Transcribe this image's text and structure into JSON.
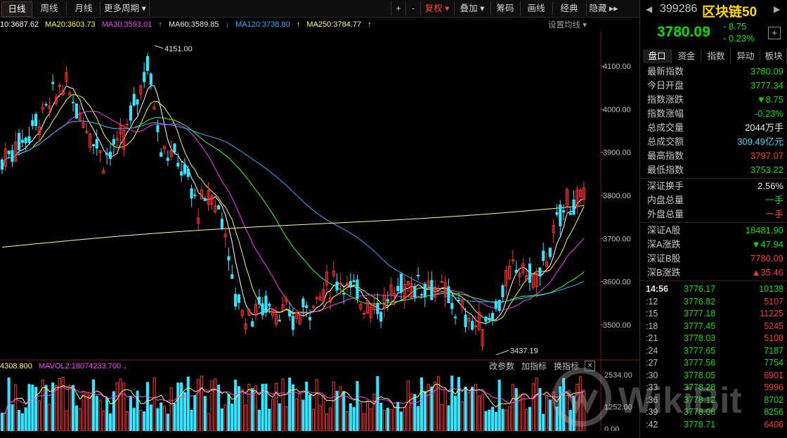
{
  "toolbar": {
    "tabs": [
      "日线",
      "周线",
      "月线",
      "更多周期 ▾"
    ],
    "right_items": [
      "+",
      "-",
      "复权 ▾",
      "叠加 ▾",
      "筹码",
      "画线",
      "经典",
      "隐藏 ▸▸"
    ]
  },
  "ma_row": {
    "ma10": "10:3687.62",
    "ma20": "MA20:3603.73",
    "ma30": "MA30:3593.01",
    "ma60": "MA60:3589.85",
    "ma120": "MA120:3738.80",
    "ma250": "MA250:3784.77",
    "settings": "设置均线 ▾"
  },
  "colors": {
    "up": "#ff3333",
    "down": "#33e6ff",
    "ma10": "#ffffff",
    "ma20": "#ffff00",
    "ma30": "#ff33ff",
    "ma60": "#33ff33",
    "ma120": "#33aaff",
    "ma250": "#ffff88"
  },
  "chart_data": {
    "type": "candlestick",
    "ylim": [
      3420,
      4180
    ],
    "y_ticks": [
      "4100.00",
      "4000.00",
      "3900.00",
      "3800.00",
      "3700.00",
      "3600.00",
      "3500.00"
    ],
    "annotations": {
      "high": "4151.00",
      "low": "3437.19"
    },
    "volume_ticks": [
      "2534.00",
      "1252.00",
      "0.00"
    ]
  },
  "volume_row": {
    "vol_label": "4308.800",
    "mavol2": "MAVOL2:18074233.700",
    "tools": [
      "改参数",
      "加指标",
      "换指标"
    ]
  },
  "panel": {
    "code": "399286",
    "name": "区块链50",
    "price": "3780.09",
    "change": "- 8.75",
    "change_pct": "- 0.23%",
    "tabs": [
      "盘口",
      "资金",
      "指数",
      "异动",
      "板块"
    ],
    "stats": [
      {
        "label": "最新指数",
        "value": "3780.09",
        "color": "g"
      },
      {
        "label": "今日开盘",
        "value": "3777.34",
        "color": "g"
      },
      {
        "label": "指数涨跌",
        "value": "▼8.75",
        "color": "g"
      },
      {
        "label": "指数涨幅",
        "value": "-0.23%",
        "color": "g"
      },
      {
        "label": "总成交量",
        "value": "2044万手",
        "color": "w"
      },
      {
        "label": "总成交额",
        "value": "309.49亿元",
        "color": "c"
      },
      {
        "label": "最高指数",
        "value": "3797.07",
        "color": "r"
      },
      {
        "label": "最低指数",
        "value": "3753.22",
        "color": "g"
      }
    ],
    "stats2": [
      {
        "label": "深证换手",
        "value": "2.56%",
        "color": "w"
      },
      {
        "label": "内盘总量",
        "value": "一手",
        "color": "g"
      },
      {
        "label": "外盘总量",
        "value": "一手",
        "color": "r"
      }
    ],
    "stats3": [
      {
        "label": "深证A股",
        "value": "18481.90",
        "color": "g"
      },
      {
        "label": "深A涨跌",
        "value": "▼47.94",
        "color": "g"
      },
      {
        "label": "深证B股",
        "value": "7780.09",
        "color": "r"
      },
      {
        "label": "深B涨跌",
        "value": "▲35.46",
        "color": "r"
      }
    ],
    "ticks": [
      {
        "time": "14:56",
        "price": "3776.17",
        "vol": "10138"
      },
      {
        "time": ":12",
        "price": "3776.82",
        "vol": "5107"
      },
      {
        "time": ":15",
        "price": "3777.18",
        "vol": "11225"
      },
      {
        "time": ":18",
        "price": "3777.45",
        "vol": "5245"
      },
      {
        "time": ":21",
        "price": "3778.03",
        "vol": "5108"
      },
      {
        "time": ":24",
        "price": "3777.65",
        "vol": "7187"
      },
      {
        "time": ":27",
        "price": "3777.56",
        "vol": "7754"
      },
      {
        "time": ":30",
        "price": "3778.05",
        "vol": "6901"
      },
      {
        "time": ":33",
        "price": "3778.28",
        "vol": "5996"
      },
      {
        "time": ":36",
        "price": "3778.12",
        "vol": "8702"
      },
      {
        "time": ":39",
        "price": "3778.06",
        "vol": "8256"
      },
      {
        "time": ":42",
        "price": "3778.71",
        "vol": "6406"
      }
    ]
  },
  "watermark": "WikiBit"
}
